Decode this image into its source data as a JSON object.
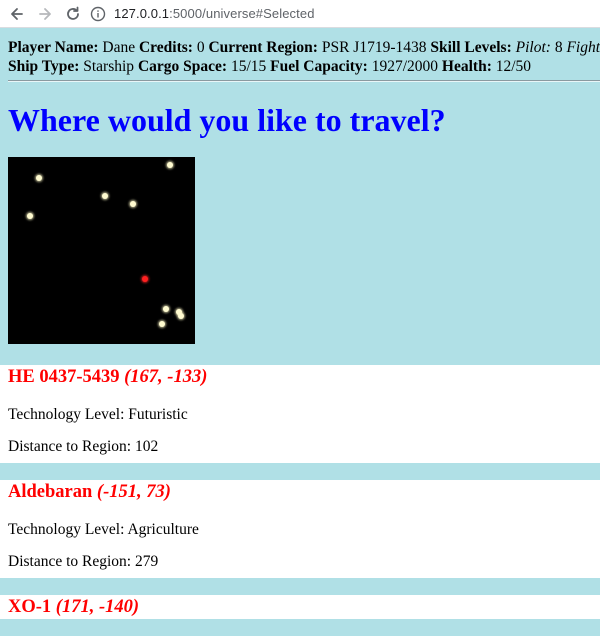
{
  "browser": {
    "url_host": "127.0.0.1",
    "url_path": ":5000/universe#Selected"
  },
  "stats": {
    "player_name_label": "Player Name:",
    "player_name": "Dane",
    "credits_label": "Credits:",
    "credits": "0",
    "current_region_label": "Current Region:",
    "current_region": "PSR J1719-1438",
    "skill_levels_label": "Skill Levels:",
    "pilot_label": "Pilot:",
    "pilot": "8",
    "fighter_label": "Fighter:",
    "ship_type_label": "Ship Type:",
    "ship_type": "Starship",
    "cargo_space_label": "Cargo Space:",
    "cargo_space": "15/15",
    "fuel_capacity_label": "Fuel Capacity:",
    "fuel_capacity": "1927/2000",
    "health_label": "Health:",
    "health": "12/50"
  },
  "title": "Where would you like to travel?",
  "map": {
    "background": "#000000",
    "star_color": "#fffbd0",
    "current_color": "#ff2020"
  },
  "regions": [
    {
      "name": "HE 0437-5439",
      "coords": "(167, -133)",
      "tech_label": "Technology Level:",
      "tech": "Futuristic",
      "distance_label": "Distance to Region:",
      "distance": "102"
    },
    {
      "name": "Aldebaran",
      "coords": "(-151, 73)",
      "tech_label": "Technology Level:",
      "tech": "Agriculture",
      "distance_label": "Distance to Region:",
      "distance": "279"
    },
    {
      "name": "XO-1",
      "coords": "(171, -140)"
    }
  ]
}
